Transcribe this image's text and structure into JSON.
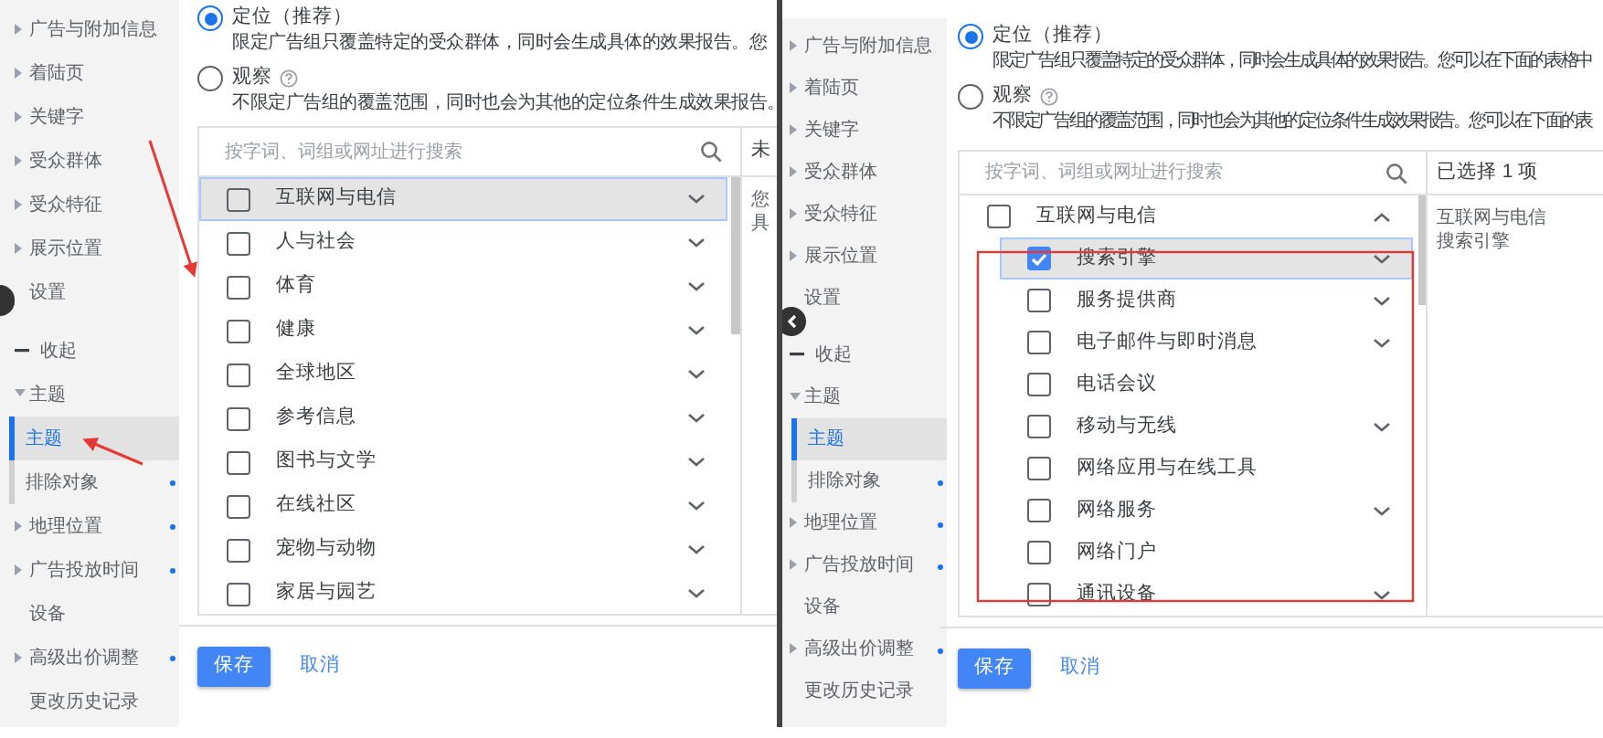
{
  "panels": [
    {
      "sidebar": [
        {
          "label": "广告与附加信息",
          "kind": "link",
          "dot": false
        },
        {
          "label": "着陆页",
          "kind": "link",
          "dot": false
        },
        {
          "label": "关键字",
          "kind": "link",
          "dot": false
        },
        {
          "label": "受众群体",
          "kind": "link",
          "dot": false
        },
        {
          "label": "受众特征",
          "kind": "link",
          "dot": false
        },
        {
          "label": "展示位置",
          "kind": "link",
          "dot": false
        },
        {
          "label": "设置",
          "kind": "plain",
          "dot": false
        },
        {
          "label": "收起",
          "kind": "collapse",
          "dot": false
        },
        {
          "label": "主题",
          "kind": "group",
          "dot": false,
          "children": [
            {
              "label": "主题",
              "dot": false,
              "selected": true
            },
            {
              "label": "排除对象",
              "dot": true,
              "selected": false
            }
          ]
        },
        {
          "label": "地理位置",
          "kind": "link",
          "dot": true
        },
        {
          "label": "广告投放时间",
          "kind": "link",
          "dot": true
        },
        {
          "label": "设备",
          "kind": "plain",
          "dot": false
        },
        {
          "label": "高级出价调整",
          "kind": "link",
          "dot": true
        },
        {
          "label": "更改历史记录",
          "kind": "plain",
          "dot": false
        }
      ],
      "targeting_options": [
        {
          "title": "定位（推荐）",
          "help": false,
          "selected": true,
          "description": "限定广告组只覆盖特定的受众群体，同时会生成具体的效果报告。您"
        },
        {
          "title": "观察",
          "help": true,
          "selected": false,
          "description": "不限定广告组的覆盖范围，同时也会为其他的定位条件生成效果报告。"
        }
      ],
      "search": {
        "placeholder": "按字词、词组或网址进行搜索"
      },
      "categories": [
        {
          "label": "互联网与电信",
          "kind": "group",
          "expanded": false,
          "checked": false,
          "selected": true
        },
        {
          "label": "人与社会",
          "kind": "group",
          "expanded": false,
          "checked": false,
          "selected": false
        },
        {
          "label": "体育",
          "kind": "group",
          "expanded": false,
          "checked": false,
          "selected": false
        },
        {
          "label": "健康",
          "kind": "group",
          "expanded": false,
          "checked": false,
          "selected": false
        },
        {
          "label": "全球地区",
          "kind": "group",
          "expanded": false,
          "checked": false,
          "selected": false
        },
        {
          "label": "参考信息",
          "kind": "group",
          "expanded": false,
          "checked": false,
          "selected": false
        },
        {
          "label": "图书与文学",
          "kind": "group",
          "expanded": false,
          "checked": false,
          "selected": false
        },
        {
          "label": "在线社区",
          "kind": "group",
          "expanded": false,
          "checked": false,
          "selected": false
        },
        {
          "label": "宠物与动物",
          "kind": "group",
          "expanded": false,
          "checked": false,
          "selected": false
        },
        {
          "label": "家居与园艺",
          "kind": "group",
          "expanded": false,
          "checked": false,
          "selected": false
        }
      ],
      "selection_pane": {
        "header": "未",
        "lines": [
          "您",
          "具"
        ]
      },
      "buttons": [
        {
          "label": "保存",
          "kind": "primary"
        },
        {
          "label": "取消",
          "kind": "link"
        }
      ]
    },
    {
      "sidebar": [
        {
          "label": "广告与附加信息",
          "kind": "link",
          "dot": false
        },
        {
          "label": "着陆页",
          "kind": "link",
          "dot": false
        },
        {
          "label": "关键字",
          "kind": "link",
          "dot": false
        },
        {
          "label": "受众群体",
          "kind": "link",
          "dot": false
        },
        {
          "label": "受众特征",
          "kind": "link",
          "dot": false
        },
        {
          "label": "展示位置",
          "kind": "link",
          "dot": false
        },
        {
          "label": "设置",
          "kind": "plain",
          "dot": false
        },
        {
          "label": "收起",
          "kind": "collapse",
          "dot": false
        },
        {
          "label": "主题",
          "kind": "group",
          "dot": false,
          "children": [
            {
              "label": "主题",
              "dot": false,
              "selected": true
            },
            {
              "label": "排除对象",
              "dot": true,
              "selected": false
            }
          ]
        },
        {
          "label": "地理位置",
          "kind": "link",
          "dot": true
        },
        {
          "label": "广告投放时间",
          "kind": "link",
          "dot": true
        },
        {
          "label": "设备",
          "kind": "plain",
          "dot": false
        },
        {
          "label": "高级出价调整",
          "kind": "link",
          "dot": true
        },
        {
          "label": "更改历史记录",
          "kind": "plain",
          "dot": false
        }
      ],
      "targeting_options": [
        {
          "title": "定位（推荐）",
          "help": false,
          "selected": true,
          "description": "限定广告组只覆盖特定的受众群体，同时会生成具体的效果报告。您可以在下面的表格中"
        },
        {
          "title": "观察",
          "help": true,
          "selected": false,
          "description": "不限定广告组的覆盖范围，同时也会为其他的定位条件生成效果报告。您可以在下面的表"
        }
      ],
      "search": {
        "placeholder": "按字词、词组或网址进行搜索"
      },
      "categories": [
        {
          "label": "互联网与电信",
          "kind": "group",
          "expanded": true,
          "checked": false,
          "selected": false,
          "children": [
            {
              "label": "搜索引擎",
              "kind": "group",
              "expanded": false,
              "checked": true,
              "selected": true
            },
            {
              "label": "服务提供商",
              "kind": "group",
              "expanded": false,
              "checked": false,
              "selected": false
            },
            {
              "label": "电子邮件与即时消息",
              "kind": "group",
              "expanded": false,
              "checked": false,
              "selected": false
            },
            {
              "label": "电话会议",
              "kind": "leaf",
              "checked": false,
              "selected": false
            },
            {
              "label": "移动与无线",
              "kind": "group",
              "expanded": false,
              "checked": false,
              "selected": false
            },
            {
              "label": "网络应用与在线工具",
              "kind": "leaf",
              "checked": false,
              "selected": false
            },
            {
              "label": "网络服务",
              "kind": "group",
              "expanded": false,
              "checked": false,
              "selected": false
            },
            {
              "label": "网络门户",
              "kind": "leaf",
              "checked": false,
              "selected": false
            },
            {
              "label": "通讯设备",
              "kind": "group",
              "expanded": false,
              "checked": false,
              "selected": false
            }
          ]
        }
      ],
      "selection_pane": {
        "header": "已选择 1 项",
        "lines": [
          "互联网与电信",
          "搜索引擎"
        ]
      },
      "buttons": [
        {
          "label": "保存",
          "kind": "primary"
        },
        {
          "label": "取消",
          "kind": "link"
        }
      ]
    }
  ]
}
